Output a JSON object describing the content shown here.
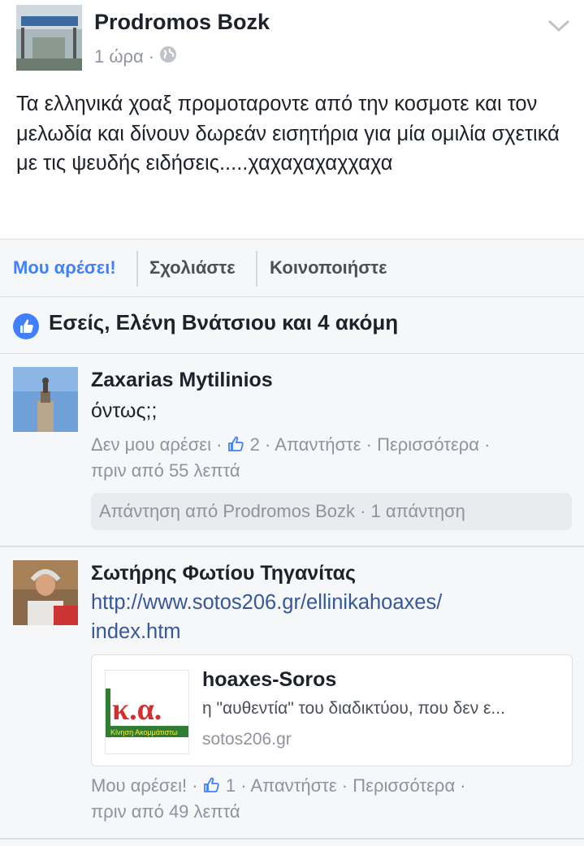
{
  "post": {
    "author": "Prodromos Bozk",
    "time": "1 ώρα",
    "separator": "·",
    "privacy_icon": "globe-icon",
    "text": "Τα ελληνικά χοαξ προμοταροντε από την κοσμοτε και τον μελωδία και δίνουν δωρεάν εισητήρια για μία ομιλία σχετικά με τις ψευδής ειδήσεις.....χαχαχαχαχχαχα"
  },
  "actions": {
    "like": "Μου αρέσει!",
    "comment": "Σχολιάστε",
    "share": "Κοινοποιήστε"
  },
  "likes": {
    "icon": "thumbs-up-icon",
    "text": "Εσείς, Ελένη Βνάτσιου και 4 ακόμη"
  },
  "comments": [
    {
      "name": "Zaxarias Mytilinios",
      "text": "όντως;;",
      "like_action": "Δεν μου αρέσει",
      "like_count": "2",
      "reply_action": "Απαντήστε",
      "more_action": "Περισσότερα",
      "time": "πριν από 55 λεπτά",
      "reply_summary": "Απάντηση από Prodromos Bozk · 1 απάντηση"
    },
    {
      "name": "Σωτήρης Φωτίου Τηγανίτας",
      "link": "http://www.sotos206.gr/ellinikahoaxes/index.htm",
      "link_line1": "http://www.sotos206.gr/ellinikahoaxes/",
      "link_line2": "index.htm",
      "card": {
        "title": "hoaxes-Soros",
        "description": "η \"αυθεντία\" του διαδικτύου, που δεν ε...",
        "domain": "sotos206.gr",
        "logo_text": "κ.α.",
        "logo_sub": "Κίνηση Ακομμάτιστω"
      },
      "like_action": "Μου αρέσει!",
      "like_count": "1",
      "reply_action": "Απαντήστε",
      "more_action": "Περισσότερα",
      "time": "πριν από 49 λεπτά"
    }
  ],
  "colors": {
    "accent": "#4080ff",
    "link": "#365899",
    "meta": "#8d949e"
  }
}
